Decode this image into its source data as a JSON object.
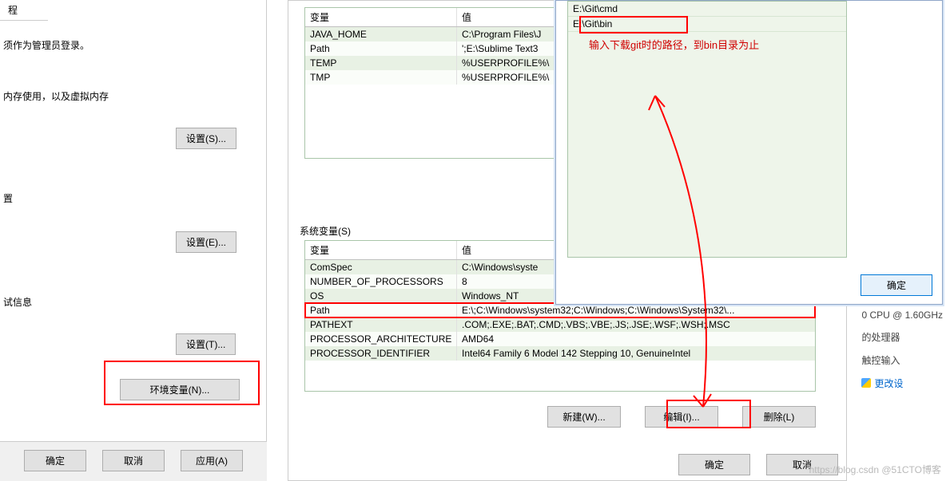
{
  "left": {
    "tab": "程",
    "line1": "须作为管理员登录。",
    "line2": "内存使用，以及虚拟内存",
    "btnS": "设置(S)...",
    "section3": "置",
    "btnE": "设置(E)...",
    "section4": "试信息",
    "btnT": "设置(T)...",
    "btnEnv": "环境变量(N)...",
    "ok": "确定",
    "cancel": "取消",
    "apply": "应用(A)"
  },
  "env": {
    "user_head_var": "变量",
    "user_head_val": "值",
    "user_rows": [
      {
        "var": "JAVA_HOME",
        "val": "C:\\Program Files\\J"
      },
      {
        "var": "Path",
        "val": "';E:\\Sublime Text3"
      },
      {
        "var": "TEMP",
        "val": "%USERPROFILE%\\"
      },
      {
        "var": "TMP",
        "val": "%USERPROFILE%\\"
      }
    ],
    "sys_label": "系统变量(S)",
    "sys_head_var": "变量",
    "sys_head_val": "值",
    "sys_rows": [
      {
        "var": "ComSpec",
        "val": "C:\\Windows\\syste"
      },
      {
        "var": "NUMBER_OF_PROCESSORS",
        "val": "8"
      },
      {
        "var": "OS",
        "val": "Windows_NT"
      },
      {
        "var": "Path",
        "val": "E:\\;C:\\Windows\\system32;C:\\Windows;C:\\Windows\\System32\\..."
      },
      {
        "var": "PATHEXT",
        "val": ".COM;.EXE;.BAT;.CMD;.VBS;.VBE;.JS;.JSE;.WSF;.WSH;.MSC"
      },
      {
        "var": "PROCESSOR_ARCHITECTURE",
        "val": "AMD64"
      },
      {
        "var": "PROCESSOR_IDENTIFIER",
        "val": "Intel64 Family 6 Model 142 Stepping 10, GenuineIntel"
      }
    ],
    "btn_new": "新建(W)...",
    "btn_edit": "编辑(I)...",
    "btn_del": "删除(L)",
    "ok": "确定",
    "cancel": "取消"
  },
  "path_dialog": {
    "items": [
      "E:\\Git\\cmd",
      "E:\\Git\\bin"
    ],
    "annotation": "输入下载git时的路径，到bin目录为止",
    "ok": "确定"
  },
  "bg": {
    "cpu": "0 CPU @ 1.60GHz",
    "proc": "的处理器",
    "touch": "触控输入",
    "change": "更改设"
  },
  "watermark": "https://blog.csdn @51CTO博客"
}
